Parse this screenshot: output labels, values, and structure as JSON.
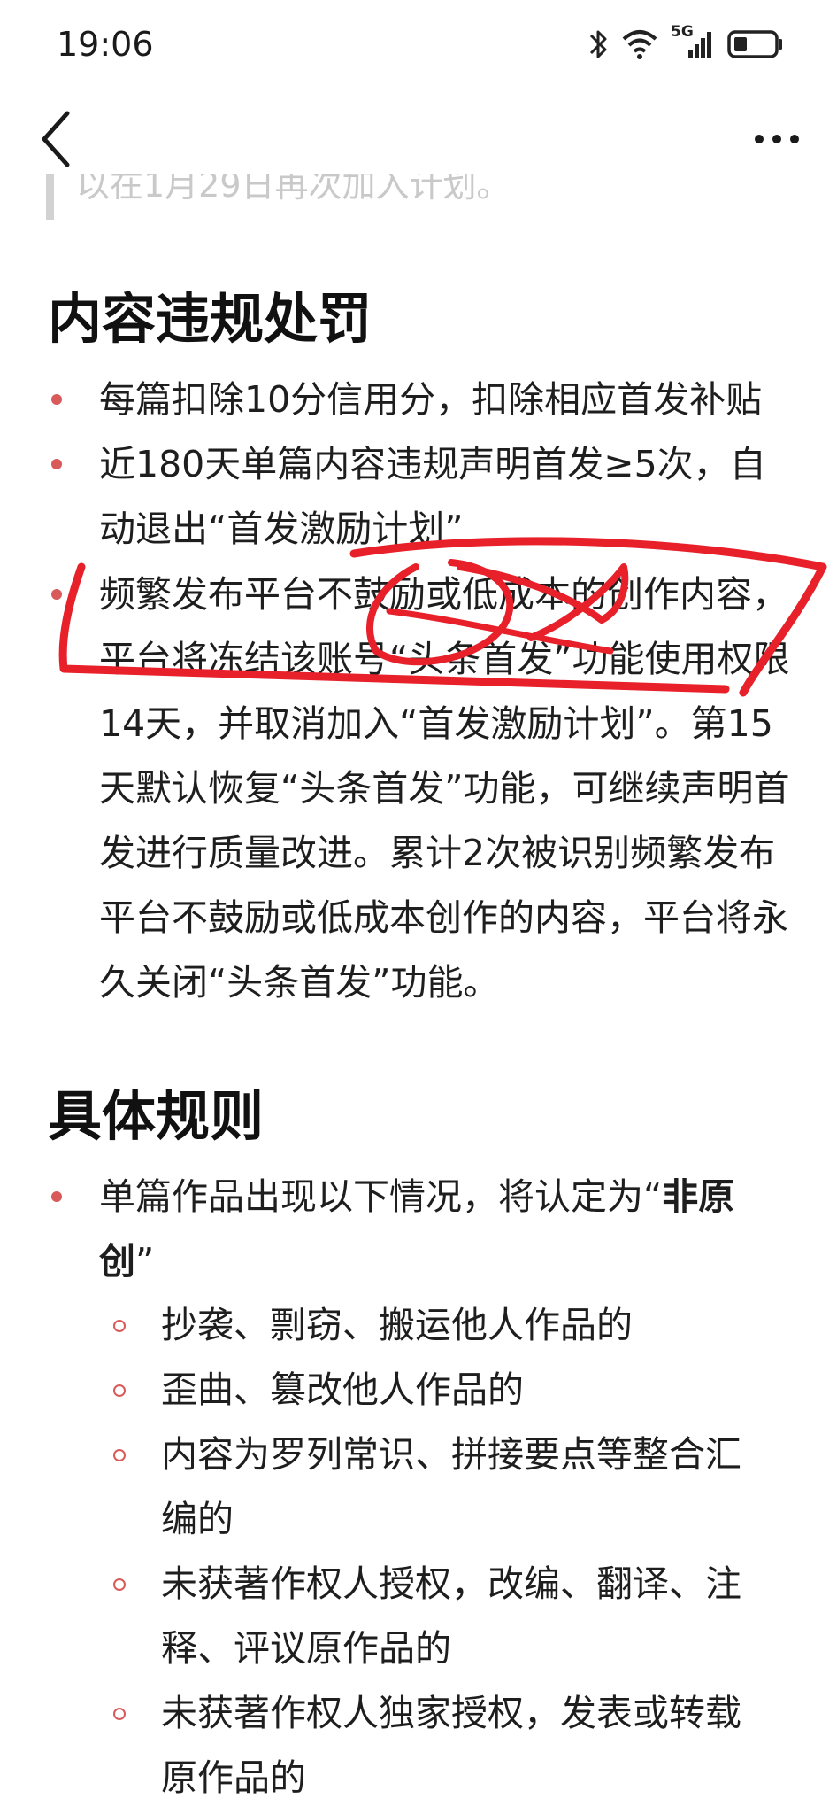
{
  "status_bar": {
    "time": "19:06",
    "network": "5G"
  },
  "nav": {
    "back_icon": "chevron-left-icon",
    "more_icon": "more-horizontal-icon"
  },
  "quote_remnant": "以在1月29日再次加入计划。",
  "section1": {
    "title": "内容违规处罚",
    "items": [
      "每篇扣除10分信用分，扣除相应首发补贴",
      "近180天单篇内容违规声明首发≥5次，自动退出“首发激励计划”",
      "频繁发布平台不鼓励或低成本的创作内容，平台将冻结该账号“头条首发”功能使用权限14天，并取消加入“首发激励计划”。第15天默认恢复“头条首发”功能，可继续声明首发进行质量改进。累计2次被识别频繁发布平台不鼓励或低成本创作的内容，平台将永久关闭“头条首发”功能。"
    ]
  },
  "section2": {
    "title": "具体规则",
    "lead_prefix": "单篇作品出现以下情况，将认定为“",
    "lead_bold": "非原创",
    "lead_suffix": "”",
    "sub_items": [
      "抄袭、剽窃、搬运他人作品的",
      "歪曲、篡改他人作品的",
      "内容为罗列常识、拼接要点等整合汇编的",
      "未获著作权人授权，改编、翻译、注释、评议原作品的",
      "未获著作权人独家授权，发表或转载原作品的"
    ]
  },
  "colors": {
    "bullet": "#d85a5a",
    "annotation": "#e8202a"
  }
}
